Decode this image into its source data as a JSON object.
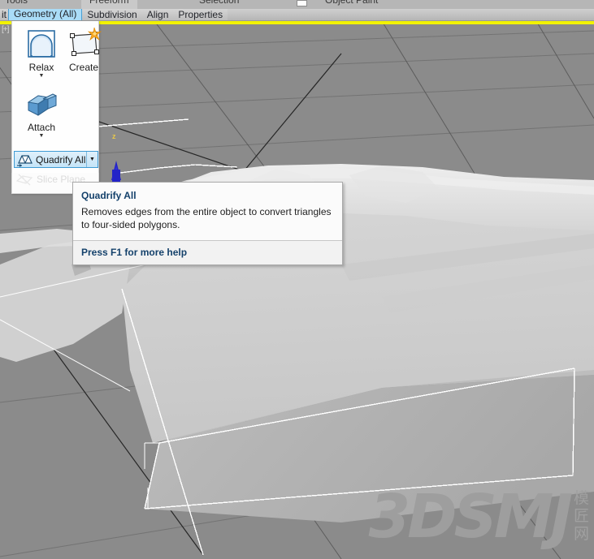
{
  "app": {
    "viewport_label": "[+]",
    "accent_yellow": "#f2f200",
    "viewport_bg": "#8b8b8b",
    "mesh_color": "#d8d8d8",
    "selection_line_color": "#ffffff",
    "highlight_blue": "#3f9bd4"
  },
  "tabs_upper": {
    "items": [
      {
        "label": "Tools",
        "selected": false
      },
      {
        "label": "Freeform",
        "selected": true
      },
      {
        "label": "Selection",
        "selected": false
      },
      {
        "label": "Object Paint",
        "selected": false
      }
    ],
    "minimize_icon": "minimize-box-icon"
  },
  "tabs_lower": {
    "items": [
      {
        "label": "it",
        "active": false
      },
      {
        "label": "Geometry (All)",
        "active": true
      },
      {
        "label": "Subdivision",
        "active": false
      },
      {
        "label": "Align",
        "active": false
      },
      {
        "label": "Properties",
        "active": false
      }
    ]
  },
  "ribbon_panel": {
    "buttons": [
      {
        "id": "relax",
        "label": "Relax",
        "icon": "relax-dome-icon",
        "has_dropdown": true
      },
      {
        "id": "create",
        "label": "Create",
        "icon": "create-polygon-icon",
        "has_dropdown": false
      },
      {
        "id": "attach",
        "label": "Attach",
        "icon": "attach-box-icon",
        "has_dropdown": true
      }
    ],
    "quadrify": {
      "label": "Quadrify All",
      "icon": "quadrify-icon",
      "dropdown_icon": "chevron-down-icon",
      "state": "hovered"
    },
    "slice_plane": {
      "label": "Slice Plane",
      "icon": "slice-plane-icon",
      "state": "disabled"
    }
  },
  "tooltip": {
    "title": "Quadrify All",
    "description": "Removes edges from the entire object to convert triangles to four-sided polygons.",
    "footer": "Press F1 for more help"
  },
  "gizmo": {
    "axis_label": "z",
    "axis_color": "#e8c84a",
    "cone_color": "#2323c8"
  },
  "watermark": {
    "main": "3DSMJ",
    "secondary": "模匠网"
  }
}
